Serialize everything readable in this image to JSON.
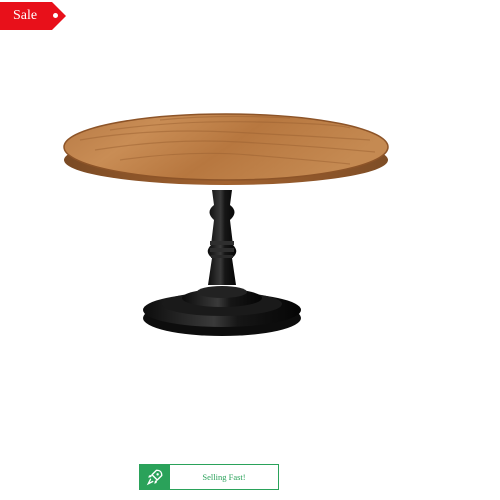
{
  "badge": {
    "sale_label": "Sale",
    "color": "#e8101a"
  },
  "product": {
    "image_icon": "cake-stand-image"
  },
  "status": {
    "selling_fast_label": "Selling Fast!",
    "icon": "rocket-icon",
    "color": "#2aa25a"
  }
}
